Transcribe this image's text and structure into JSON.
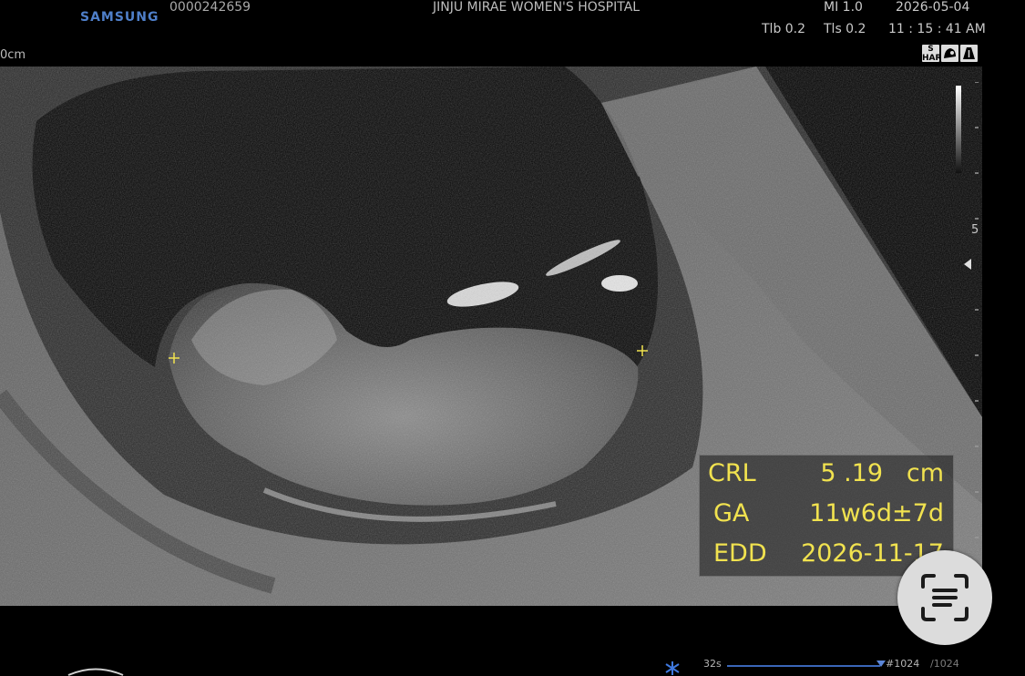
{
  "header": {
    "brand": "SAMSUNG",
    "patient_id": "0000242659",
    "hospital": "JINJU MIRAE WOMEN'S HOSPITAL",
    "mi": "MI 1.0",
    "date": "2026-05-04",
    "tib": "Tlb 0.2",
    "tis": "Tls 0.2",
    "time": "11 : 15 : 41 AM",
    "depth_unit": "0cm"
  },
  "mode_icons": [
    {
      "name": "har-mode-icon",
      "label": "S HAR"
    },
    {
      "name": "fetal-mode-icon",
      "label": ""
    },
    {
      "name": "transducer-mode-icon",
      "label": ""
    }
  ],
  "scale": {
    "label": "5"
  },
  "measurements": [
    {
      "label": "CRL",
      "value": "5 .19   cm"
    },
    {
      "label": "GA",
      "value": "11w6d±7d"
    },
    {
      "label": "EDD",
      "value": "2026-11-17"
    }
  ],
  "footer": {
    "cine_time": "32s",
    "frame_counter": "#1024",
    "frame_total": "/1024"
  },
  "colors": {
    "measure_text": "#f1e24f",
    "brand": "#4f7fc9",
    "cine_bar": "#3a66b8"
  }
}
